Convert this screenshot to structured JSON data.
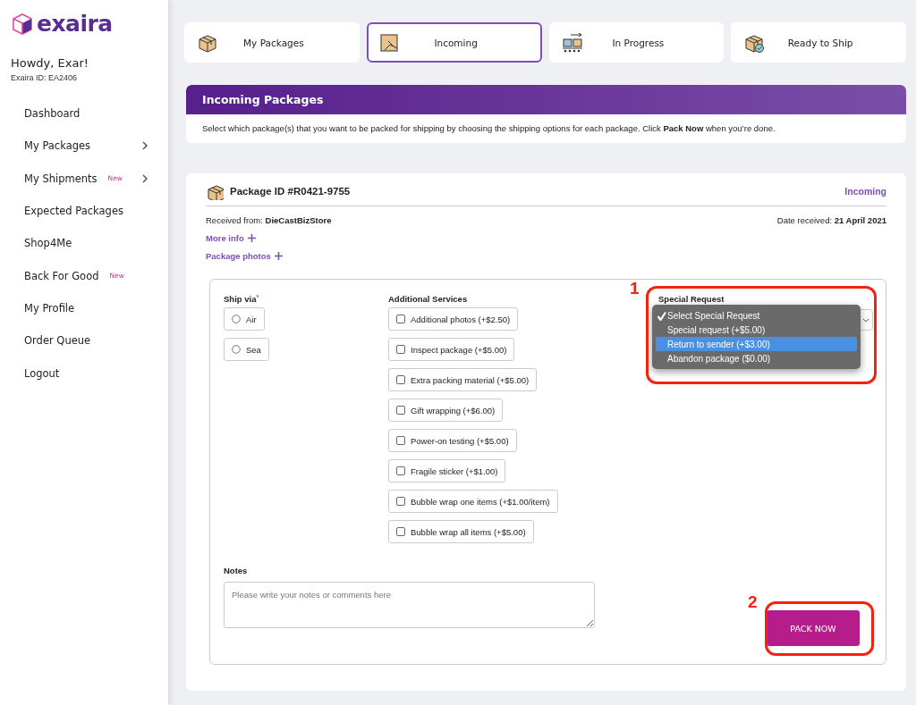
{
  "sidebar": {
    "logo": "exaira",
    "greeting": "Howdy, Exar!",
    "user_id": "Exaira ID: EA2406",
    "items": [
      {
        "label": "Dashboard",
        "expandable": false
      },
      {
        "label": "My Packages",
        "expandable": true
      },
      {
        "label": "My Shipments",
        "badge": "New",
        "expandable": true
      },
      {
        "label": "Expected Packages",
        "expandable": false
      },
      {
        "label": "Shop4Me",
        "expandable": false
      },
      {
        "label": "Back For Good",
        "badge": "New",
        "expandable": false
      },
      {
        "label": "My Profile",
        "expandable": false
      },
      {
        "label": "Order Queue",
        "expandable": false
      },
      {
        "label": "Logout",
        "expandable": false
      }
    ]
  },
  "tabs": [
    {
      "label": "My Packages",
      "selected": false
    },
    {
      "label": "Incoming",
      "selected": true
    },
    {
      "label": "In Progress",
      "selected": false
    },
    {
      "label": "Ready to Ship",
      "selected": false
    }
  ],
  "intro": {
    "title": "Incoming Packages",
    "text": "Select which package(s) that you want to be packed for shipping by choosing the shipping options for each package. Click **Pack Now** when you’re done."
  },
  "package": {
    "title": "Package ID #R0421-9755",
    "status": "Incoming",
    "received_from_label": "Received from:",
    "received_from": "DieCastBizStore",
    "date_label": "Date received:",
    "date": "21 April 2021",
    "links": [
      "More info",
      "Package photos"
    ],
    "ship_via": {
      "label": "Ship via",
      "required_mark": "*",
      "options": [
        {
          "label": "Air",
          "checked": false
        },
        {
          "label": "Sea",
          "checked": false
        }
      ]
    },
    "additional_services": {
      "label": "Additional Services",
      "options": [
        {
          "label": "Additional photos (+$2.50)",
          "checked": false
        },
        {
          "label": "Inspect package (+$5.00)",
          "checked": false
        },
        {
          "label": "Extra packing material (+$5.00)",
          "checked": false
        },
        {
          "label": "Gift wrapping (+$6.00)",
          "checked": false
        },
        {
          "label": "Power-on testing (+$5.00)",
          "checked": false
        },
        {
          "label": "Fragile sticker (+$1.00)",
          "checked": false
        },
        {
          "label": "Bubble wrap one items (+$1.00/item)",
          "checked": false
        },
        {
          "label": "Bubble wrap all items (+$5.00)",
          "checked": false
        }
      ]
    },
    "special_request": {
      "label": "Special Request",
      "open": true,
      "options": [
        {
          "label": "Select Special Request",
          "selected": true,
          "highlighted": false
        },
        {
          "label": "Special request (+$5.00)",
          "selected": false,
          "highlighted": false
        },
        {
          "label": "Return to sender (+$3.00)",
          "selected": false,
          "highlighted": true
        },
        {
          "label": "Abandon package ($0.00)",
          "selected": false,
          "highlighted": false
        }
      ]
    },
    "notes": {
      "label": "Notes",
      "placeholder": "Please write your notes or comments here"
    },
    "submit": "PACK NOW"
  },
  "annotations": [
    {
      "number": "1"
    },
    {
      "number": "2"
    }
  ]
}
